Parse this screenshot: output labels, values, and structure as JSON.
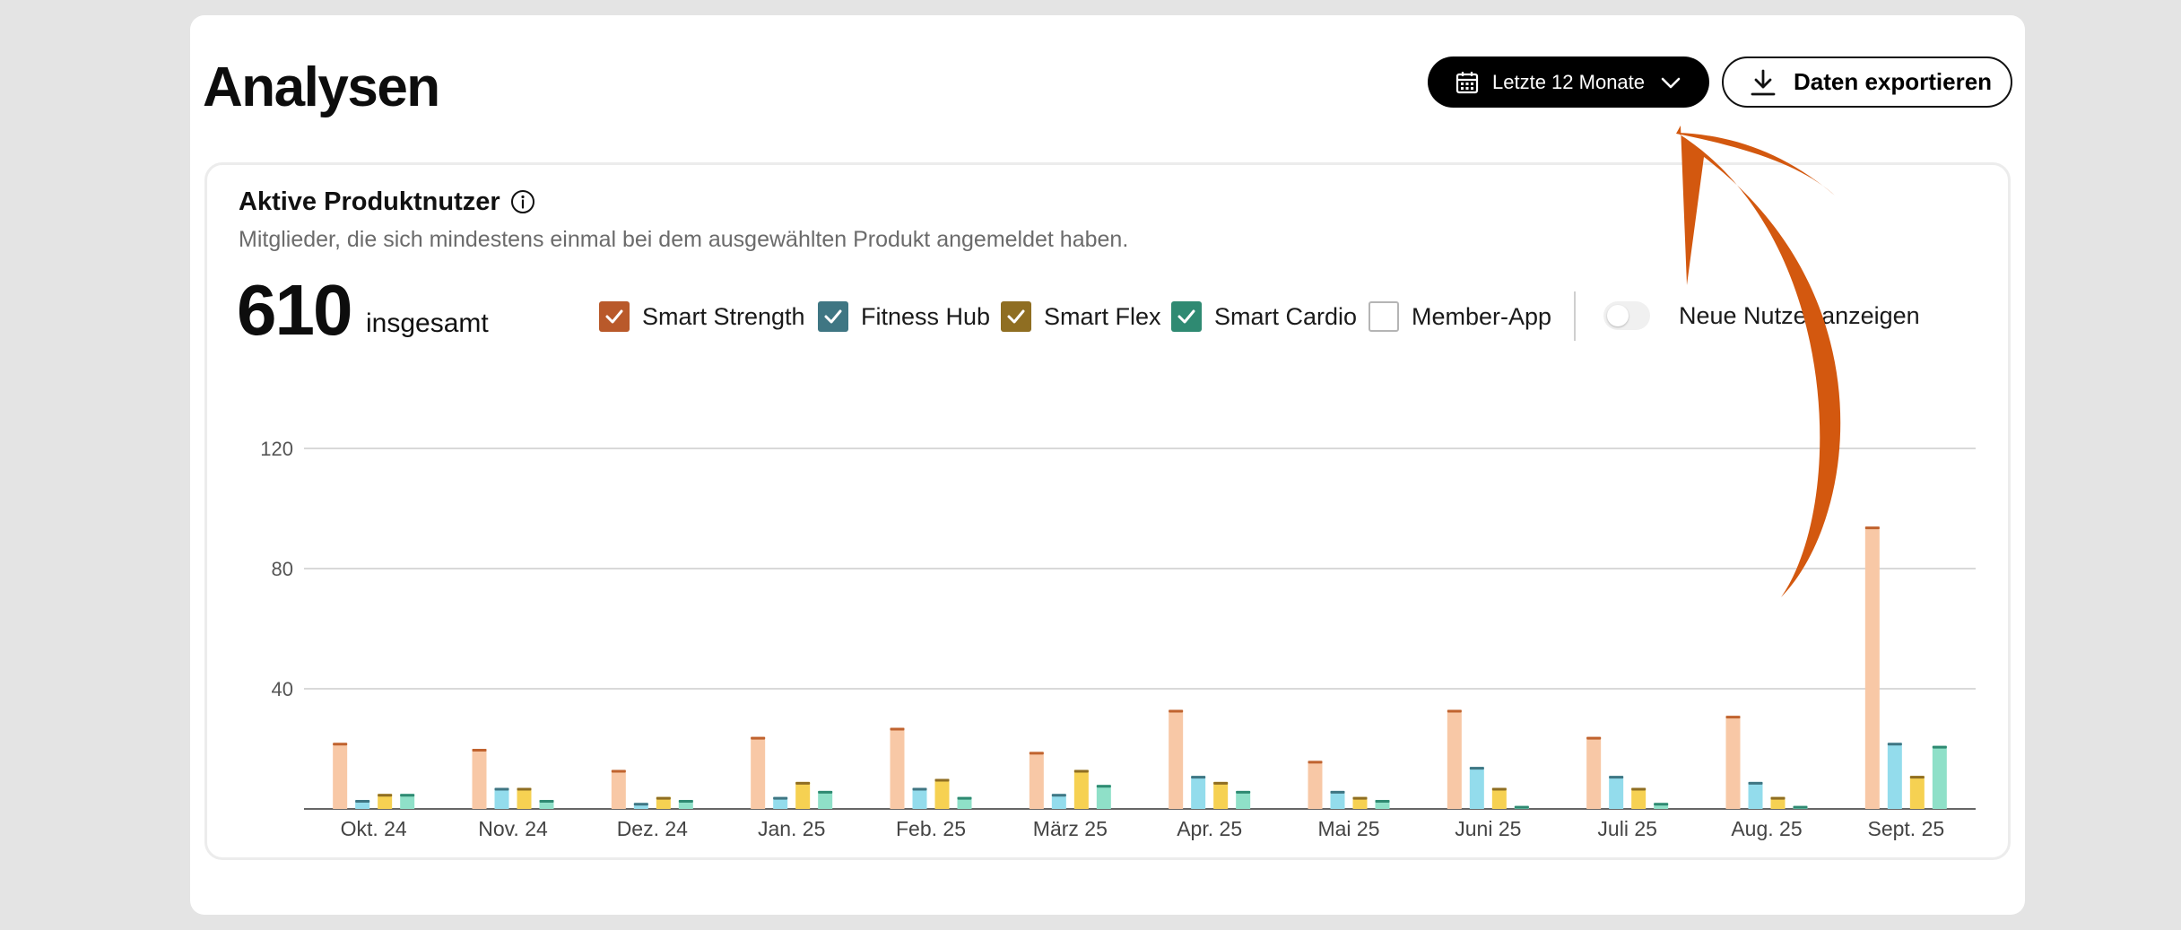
{
  "header": {
    "title": "Analysen",
    "period_label": "Letzte 12 Monate",
    "export_label": "Daten exportieren"
  },
  "card": {
    "title": "Aktive Produktnutzer",
    "subtitle": "Mitglieder, die sich mindestens einmal bei dem ausgewählten Produkt angemeldet haben.",
    "total": "610",
    "total_label": "insgesamt",
    "legend": [
      {
        "label": "Smart Strength",
        "checked": true,
        "color": "#b9592a"
      },
      {
        "label": "Fitness Hub",
        "checked": true,
        "color": "#3f7683"
      },
      {
        "label": "Smart Flex",
        "checked": true,
        "color": "#8f6e22"
      },
      {
        "label": "Smart Cardio",
        "checked": true,
        "color": "#2f8a72"
      },
      {
        "label": "Member-App",
        "checked": false,
        "color": "#b5b5b5"
      }
    ],
    "toggle_label": "Neue Nutzer anzeigen",
    "toggle_on": false
  },
  "colors": {
    "accent_arrow": "#d3580f"
  },
  "chart_data": {
    "type": "bar",
    "categories": [
      "Okt. 24",
      "Nov. 24",
      "Dez. 24",
      "Jan. 25",
      "Feb. 25",
      "März 25",
      "Apr. 25",
      "Mai 25",
      "Juni 25",
      "Juli 25",
      "Aug. 25",
      "Sept. 25"
    ],
    "series": [
      {
        "name": "Smart Strength",
        "color": "#f8c8a6",
        "cap": "#c0632f",
        "values": [
          22,
          20,
          13,
          24,
          27,
          19,
          33,
          16,
          33,
          24,
          31,
          94
        ]
      },
      {
        "name": "Fitness Hub",
        "color": "#93dcec",
        "cap": "#3f7683",
        "values": [
          3,
          7,
          2,
          4,
          7,
          5,
          11,
          6,
          14,
          11,
          9,
          22
        ]
      },
      {
        "name": "Smart Flex",
        "color": "#f6d152",
        "cap": "#8f6e22",
        "values": [
          5,
          7,
          4,
          9,
          10,
          13,
          9,
          4,
          7,
          7,
          4,
          11
        ]
      },
      {
        "name": "Smart Cardio",
        "color": "#8fe0c8",
        "cap": "#2f8a72",
        "values": [
          5,
          3,
          3,
          6,
          4,
          8,
          6,
          3,
          1,
          2,
          1,
          21
        ]
      }
    ],
    "y_ticks": [
      40,
      80,
      120
    ],
    "ylim": [
      0,
      120
    ],
    "grid": true
  }
}
